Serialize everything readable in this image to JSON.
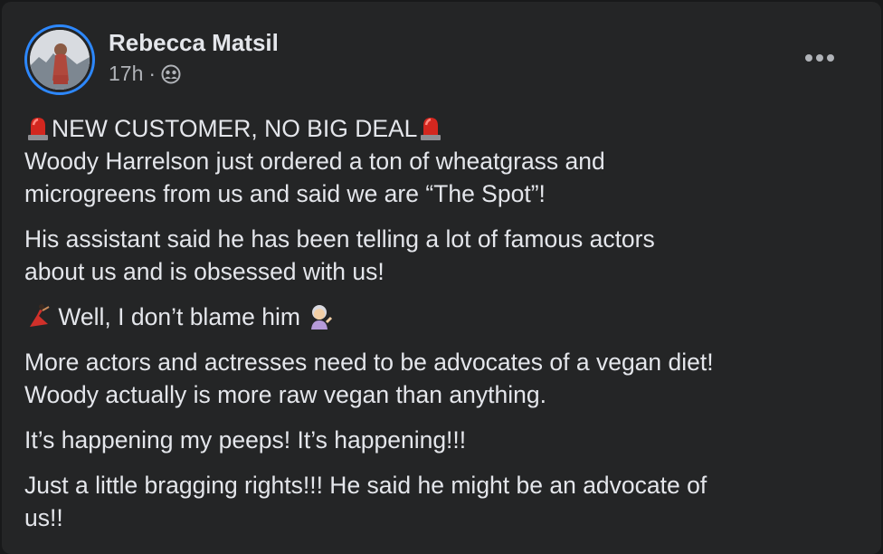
{
  "post": {
    "author": "Rebecca Matsil",
    "timestamp": "17h",
    "separator": "·",
    "audience_icon": "friends-icon",
    "menu_icon": "more-options-icon",
    "accent_color": "#2d88ff",
    "paragraphs": [
      {
        "lines": [
          {
            "emoji_left": "siren-emoji",
            "text": "NEW CUSTOMER, NO BIG DEAL",
            "emoji_right": "siren-emoji"
          },
          {
            "text": "Woody Harrelson just ordered a ton of wheatgrass and"
          },
          {
            "text": "microgreens from us and said we are “The Spot”!"
          }
        ]
      },
      {
        "lines": [
          {
            "text": "His assistant said he has been telling a lot of famous actors"
          },
          {
            "text": "about us and is obsessed with us!"
          }
        ]
      },
      {
        "lines": [
          {
            "emoji_left": "dancer-emoji",
            "text": "Well, I don’t blame him",
            "emoji_right": "tipping-hand-woman-emoji"
          }
        ]
      },
      {
        "lines": [
          {
            "text": "More actors and actresses need to be advocates of a vegan diet!"
          },
          {
            "text": "Woody actually is more raw vegan than anything."
          }
        ]
      },
      {
        "lines": [
          {
            "text": "It’s happening my peeps! It’s happening!!!"
          }
        ]
      },
      {
        "lines": [
          {
            "text": "Just a little bragging rights!!! He said he might be an advocate of"
          },
          {
            "text": "us!!"
          }
        ]
      }
    ]
  }
}
